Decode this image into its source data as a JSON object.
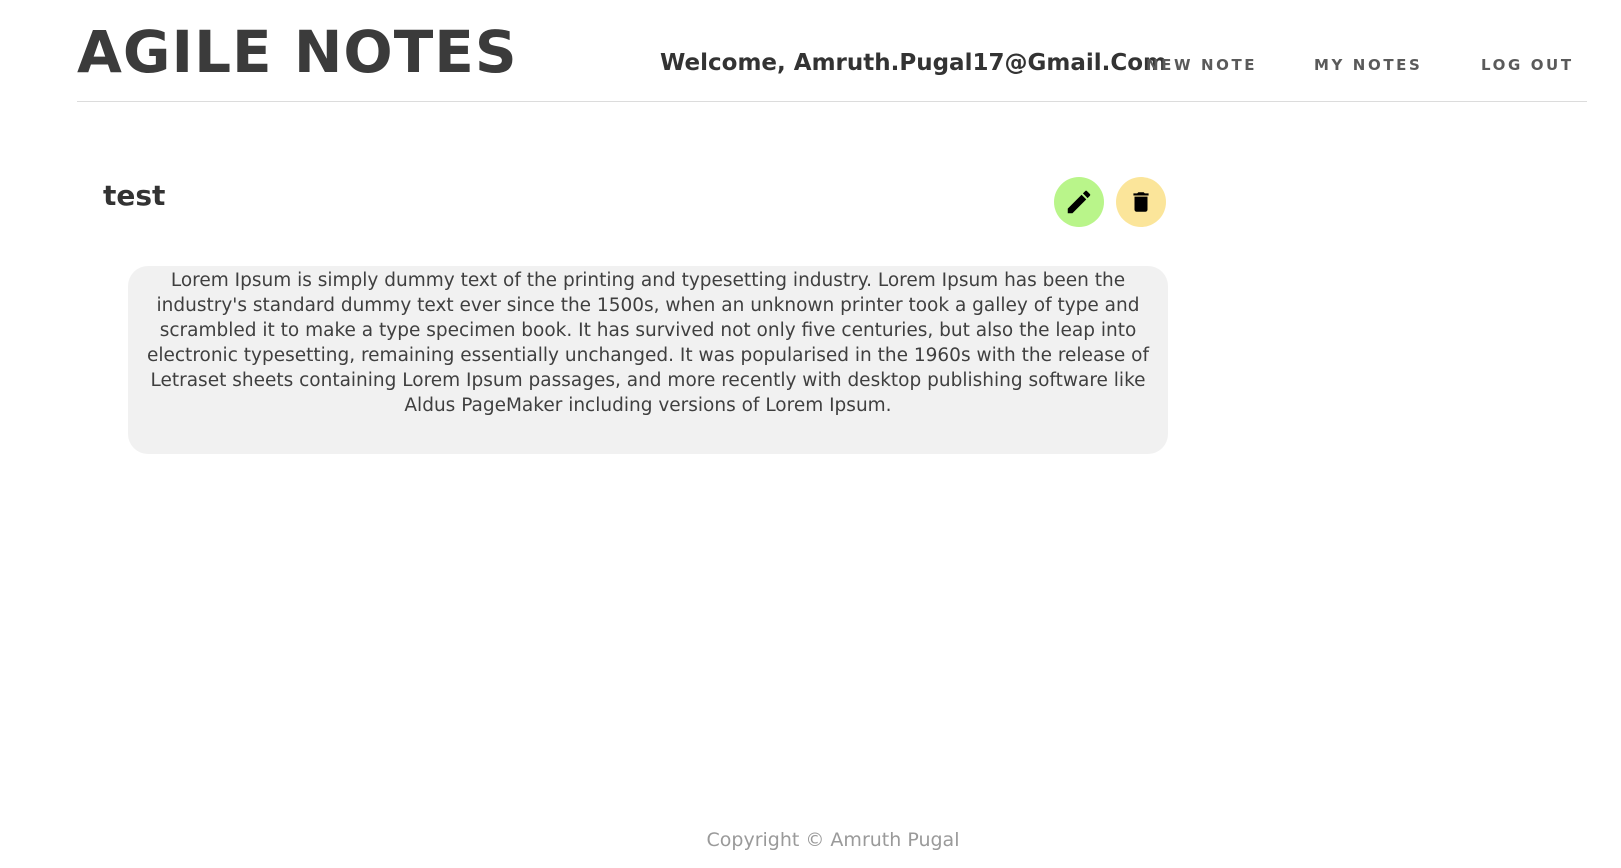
{
  "header": {
    "brand": "AGILE NOTES",
    "welcome": "Welcome, Amruth.Pugal17@Gmail.Com",
    "nav": {
      "new_note": "NEW NOTE",
      "my_notes": "MY NOTES",
      "log_out": "LOG OUT"
    }
  },
  "note": {
    "title": "test",
    "body": "Lorem Ipsum is simply dummy text of the printing and typesetting industry. Lorem Ipsum has been the industry's standard dummy text ever since the 1500s, when an unknown printer took a galley of type and scrambled it to make a type specimen book. It has survived not only five centuries, but also the leap into electronic typesetting, remaining essentially unchanged. It was popularised in the 1960s with the release of Letraset sheets containing Lorem Ipsum passages, and more recently with desktop publishing software like Aldus PageMaker including versions of Lorem Ipsum.",
    "edit_icon": "pencil-icon",
    "delete_icon": "trash-icon"
  },
  "footer": {
    "copyright": "Copyright © Amruth Pugal"
  },
  "colors": {
    "edit_button_bg": "#b9f58a",
    "delete_button_bg": "#fbe59a",
    "note_body_bg": "#f1f1f1"
  }
}
